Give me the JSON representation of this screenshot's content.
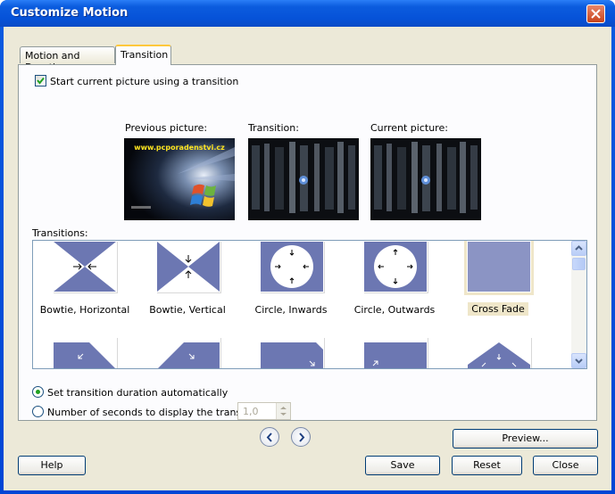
{
  "window": {
    "title": "Customize Motion"
  },
  "tabs": [
    {
      "label": "Motion and Duration",
      "active": false
    },
    {
      "label": "Transition",
      "active": true
    }
  ],
  "transition_tab": {
    "start_checkbox": {
      "label": "Start current picture using a transition",
      "checked": true
    },
    "previous_label": "Previous picture:",
    "transition_label": "Transition:",
    "current_label": "Current picture:",
    "watermark": "www.pcporadenstvi.cz",
    "transitions_label": "Transitions:",
    "transitions": [
      {
        "label": "Bowtie, Horizontal",
        "selected": false
      },
      {
        "label": "Bowtie, Vertical",
        "selected": false
      },
      {
        "label": "Circle, Inwards",
        "selected": false
      },
      {
        "label": "Circle, Outwards",
        "selected": false
      },
      {
        "label": "Cross Fade",
        "selected": true
      }
    ],
    "radio_auto": {
      "label": "Set transition duration automatically",
      "selected": true
    },
    "radio_seconds": {
      "label": "Number of seconds to display the transition",
      "selected": false
    },
    "seconds_value": "1,0"
  },
  "buttons": {
    "preview": "Preview...",
    "help": "Help",
    "save": "Save",
    "reset": "Reset",
    "close": "Close"
  },
  "colors": {
    "titlebar": "#0b5cde",
    "transition_blue": "#6c77b2",
    "selected_highlight": "#efe6c9"
  }
}
